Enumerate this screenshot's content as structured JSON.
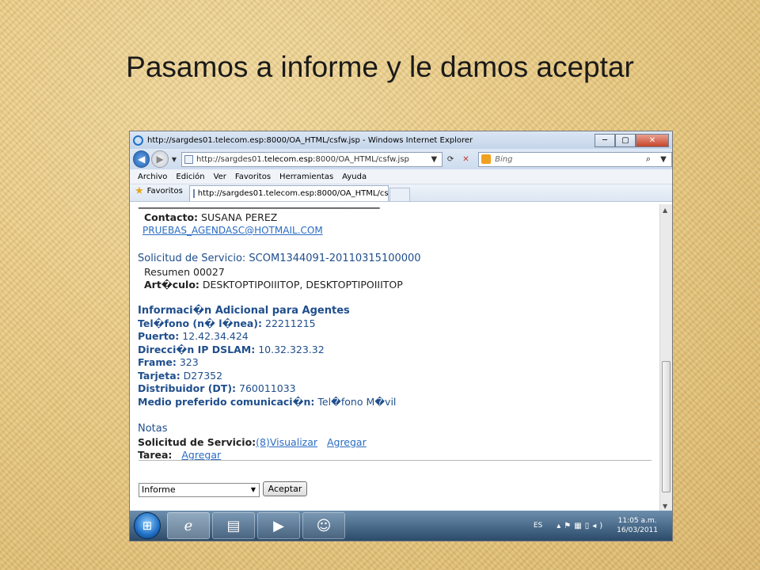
{
  "slide": {
    "title": "Pasamos a informe y le damos aceptar"
  },
  "window": {
    "title": "http://sargdes01.telecom.esp:8000/OA_HTML/csfw.jsp - Windows Internet Explorer",
    "minimize": "─",
    "maximize": "▢",
    "close": "✕"
  },
  "address": {
    "url_prefix": "http://sargdes01.",
    "url_host": "telecom.esp",
    "url_suffix": ":8000/OA_HTML/csfw.jsp",
    "search_placeholder": "Bing"
  },
  "menu": [
    "Archivo",
    "Edición",
    "Ver",
    "Favoritos",
    "Herramientas",
    "Ayuda"
  ],
  "favorites": {
    "label": "Favoritos",
    "tab_title": "http://sargdes01.telecom.esp:8000/OA_HTML/cs..."
  },
  "content": {
    "contact_label": "Contacto:",
    "contact_value": "SUSANA PEREZ",
    "email": "PRUEBAS_AGENDASC@HOTMAIL.COM",
    "request_heading": "Solicitud de Servicio: SCOM1344091-20110315100000",
    "summary": "Resumen 00027",
    "article_label": "Art�culo:",
    "article_value": "DESKTOPTIPOIIITOP, DESKTOPTIPOIIITOP",
    "info_heading": "Informaci�n Adicional para Agentes",
    "fields": [
      {
        "label": "Tel�fono (n� l�nea):",
        "value": "22211215"
      },
      {
        "label": "Puerto:",
        "value": "12.42.34.424"
      },
      {
        "label": "Direcci�n IP DSLAM:",
        "value": "10.32.323.32"
      },
      {
        "label": "Frame:",
        "value": "323"
      },
      {
        "label": "Tarjeta:",
        "value": "D27352"
      },
      {
        "label": "Distribuidor (DT):",
        "value": "760011033"
      },
      {
        "label": "Medio preferido comunicaci�n:",
        "value": "Tel�fono M�vil"
      }
    ],
    "notes_heading": "Notas",
    "notes_request_label": "Solicitud de Servicio:",
    "notes_view_link": "(8)Visualizar",
    "notes_add_link": "Agregar",
    "task_label": "Tarea:",
    "task_add_link": "Agregar",
    "select_value": "Informe",
    "accept_button": "Aceptar"
  },
  "taskbar": {
    "language": "ES",
    "time": "11:05 a.m.",
    "date": "16/03/2011"
  }
}
